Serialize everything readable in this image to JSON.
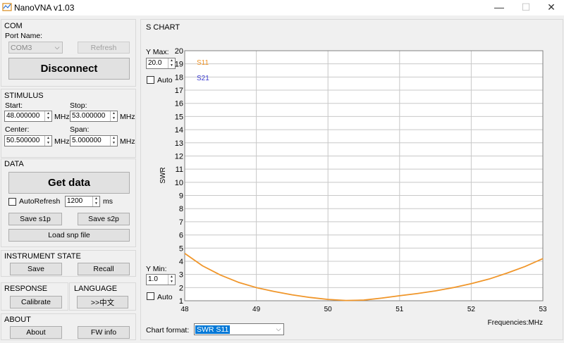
{
  "window": {
    "title": "NanoVNA v1.03",
    "minimize": "—",
    "maximize": "☐",
    "close": "✕"
  },
  "com": {
    "title": "COM",
    "port_label": "Port Name:",
    "port_value": "COM3",
    "refresh_label": "Refresh",
    "disconnect_label": "Disconnect"
  },
  "stimulus": {
    "title": "STIMULUS",
    "start_label": "Start:",
    "start_value": "48.000000",
    "stop_label": "Stop:",
    "stop_value": "53.000000",
    "center_label": "Center:",
    "center_value": "50.500000",
    "span_label": "Span:",
    "span_value": "5.000000",
    "unit": "MHz"
  },
  "data_group": {
    "title": "DATA",
    "get_data_label": "Get data",
    "autorefresh_label": "AutoRefresh",
    "interval_value": "1200",
    "interval_unit": "ms",
    "save_s1p_label": "Save s1p",
    "save_s2p_label": "Save s2p",
    "load_snp_label": "Load snp file"
  },
  "instrument_state": {
    "title": "INSTRUMENT STATE",
    "save_label": "Save",
    "recall_label": "Recall"
  },
  "response": {
    "title": "RESPONSE",
    "calibrate_label": "Calibrate"
  },
  "language": {
    "title": "LANGUAGE",
    "switch_label": ">>中文"
  },
  "about": {
    "title": "ABOUT",
    "about_label": "About",
    "fw_info_label": "FW info"
  },
  "chart_panel": {
    "title": "S CHART",
    "ymax_label": "Y Max:",
    "ymax_value": "20.0",
    "ymin_label": "Y Min:",
    "ymin_value": "1.0",
    "auto_label": "Auto",
    "format_label": "Chart format:",
    "format_value": "SWR S11"
  },
  "colors": {
    "s11": "#f0962a",
    "s21": "#3a3ad0",
    "grid": "#c8c8c8",
    "selection": "#0078d7"
  },
  "chart_data": {
    "type": "line",
    "ylabel": "SWR",
    "xlabel": "Frequencies:MHz",
    "xlim": [
      48,
      53
    ],
    "ylim": [
      1,
      20
    ],
    "x_ticks": [
      "48",
      "49",
      "50",
      "51",
      "52",
      "53"
    ],
    "y_ticks": [
      "1",
      "2",
      "3",
      "4",
      "5",
      "6",
      "7",
      "8",
      "9",
      "10",
      "11",
      "12",
      "13",
      "14",
      "15",
      "16",
      "17",
      "18",
      "19",
      "20"
    ],
    "series": [
      {
        "name": "S11",
        "x": [
          48,
          48.25,
          48.5,
          48.75,
          49,
          49.25,
          49.5,
          49.75,
          50,
          50.25,
          50.5,
          50.75,
          51,
          51.25,
          51.5,
          51.75,
          52,
          52.25,
          52.5,
          52.75,
          53
        ],
        "values": [
          4.6,
          3.65,
          2.95,
          2.4,
          2.0,
          1.7,
          1.45,
          1.25,
          1.1,
          1.02,
          1.05,
          1.2,
          1.38,
          1.55,
          1.75,
          2.0,
          2.3,
          2.65,
          3.1,
          3.6,
          4.2
        ]
      },
      {
        "name": "S21",
        "x": [],
        "values": []
      }
    ]
  }
}
